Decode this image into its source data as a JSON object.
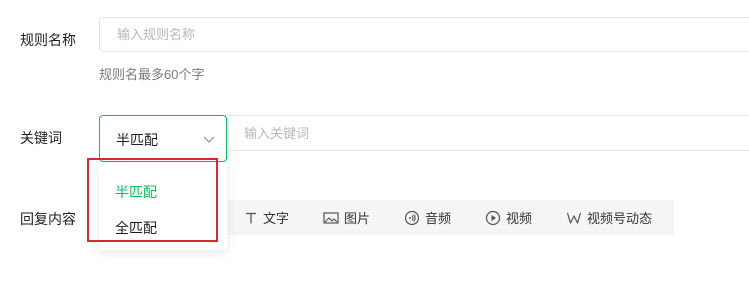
{
  "form": {
    "rule_name": {
      "label": "规则名称",
      "placeholder": "输入规则名称",
      "value": "",
      "hint": "规则名最多60个字"
    },
    "keyword": {
      "label": "关键词",
      "match_mode": "半匹配",
      "placeholder": "输入关键词",
      "value": ""
    },
    "reply": {
      "label": "回复内容",
      "tools": [
        {
          "label": "文字",
          "icon": "text-icon"
        },
        {
          "label": "图片",
          "icon": "image-icon"
        },
        {
          "label": "音频",
          "icon": "audio-icon"
        },
        {
          "label": "视频",
          "icon": "video-icon"
        },
        {
          "label": "视频号动态",
          "icon": "channels-icon"
        }
      ]
    }
  },
  "dropdown": {
    "options": [
      {
        "label": "半匹配",
        "selected": true
      },
      {
        "label": "全匹配",
        "selected": false
      }
    ]
  },
  "colors": {
    "accent": "#07c160",
    "annotation": "#d62b2b"
  }
}
